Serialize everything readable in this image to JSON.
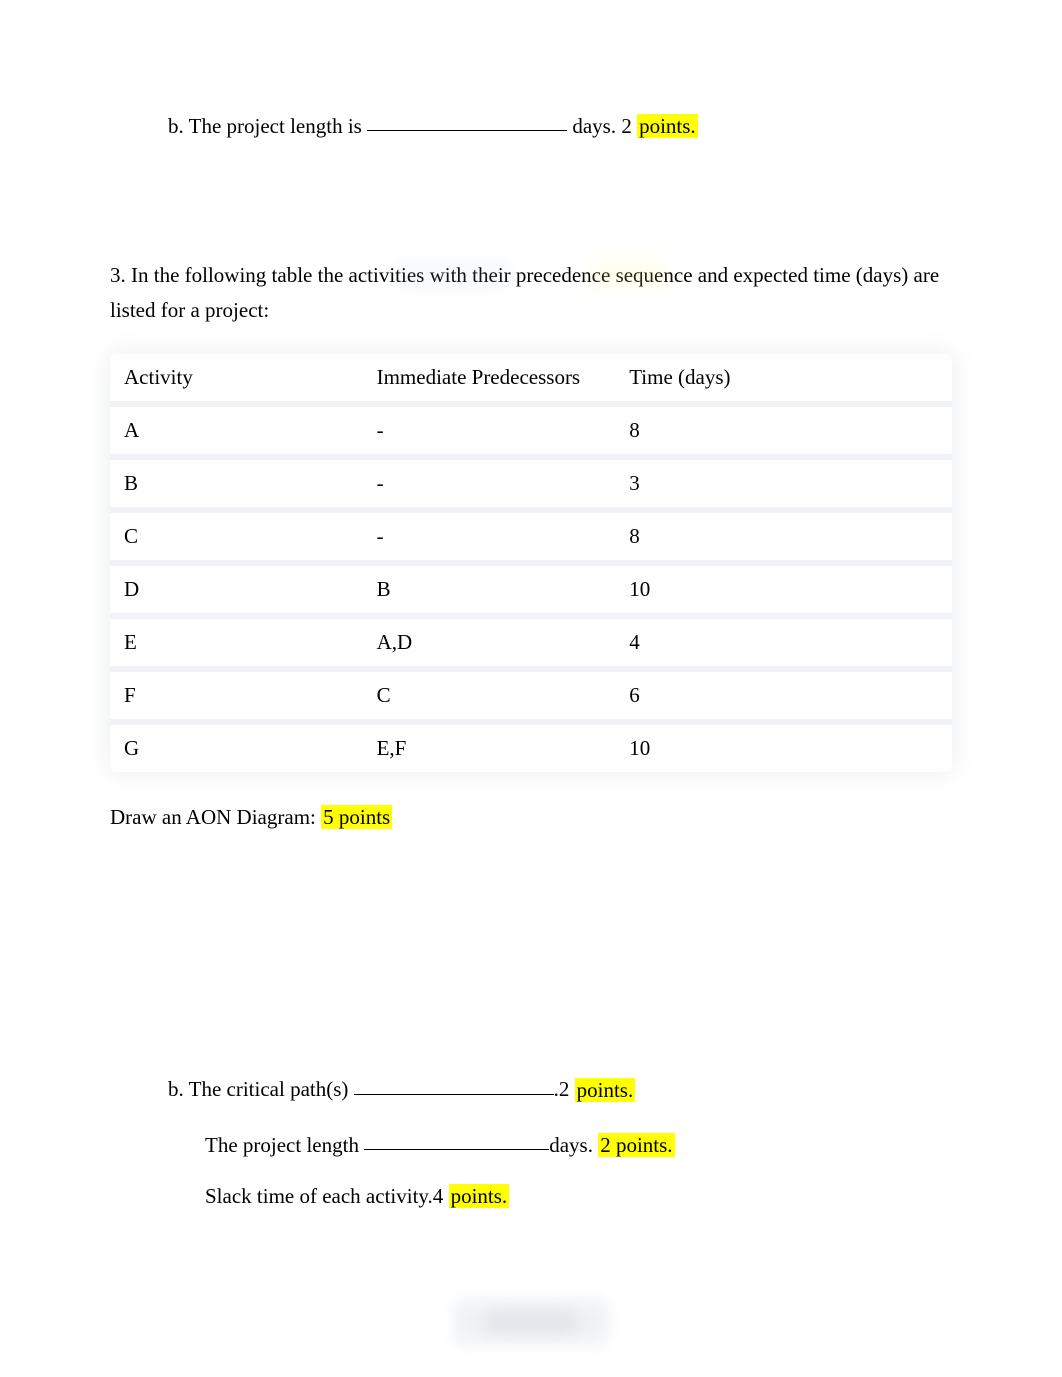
{
  "question_b1": {
    "prefix": "b. The project length is ",
    "suffix_plain": " days. 2 ",
    "points_highlight": "points."
  },
  "question3": {
    "intro": "3. In the following table the activities with their precedence sequence and expected time (days) are listed for a project:"
  },
  "table": {
    "headers": {
      "activity": "Activity",
      "pred": "Immediate Predecessors",
      "time": "Time (days)"
    },
    "rows": [
      {
        "activity": "A",
        "pred": "-",
        "time": "8"
      },
      {
        "activity": "B",
        "pred": "-",
        "time": "3"
      },
      {
        "activity": "C",
        "pred": "-",
        "time": "8"
      },
      {
        "activity": "D",
        "pred": "B",
        "time": "10"
      },
      {
        "activity": "E",
        "pred": "A,D",
        "time": "4"
      },
      {
        "activity": "F",
        "pred": "C",
        "time": "6"
      },
      {
        "activity": "G",
        "pred": "E,F",
        "time": "10"
      }
    ]
  },
  "aon": {
    "text": "Draw an AON Diagram: ",
    "points": "5 points"
  },
  "answers": {
    "critical_path": {
      "prefix": "b. The critical path(s) ",
      "suffix_plain": ".2 ",
      "points_highlight": "points."
    },
    "project_length": {
      "prefix": "The project length ",
      "suffix_plain": "days. ",
      "points_highlight": "2 points."
    },
    "slack": {
      "prefix": "Slack time of each activity.4 ",
      "points_highlight": "points."
    }
  }
}
